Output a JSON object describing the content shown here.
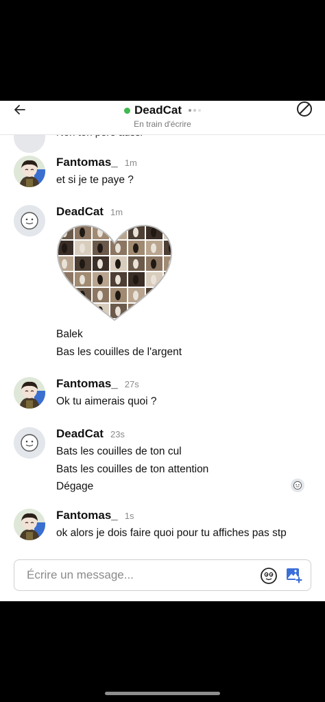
{
  "header": {
    "title": "DeadCat",
    "subtitle": "En train d'écrire",
    "online_color": "#3fb950",
    "back_icon": "arrow-left-icon",
    "block_icon": "block-icon"
  },
  "partial_message": "Non ton père aussi",
  "messages": [
    {
      "author": "Fantomas_",
      "time": "1m",
      "lines": [
        "et si je te paye ?"
      ]
    },
    {
      "author": "DeadCat",
      "time": "1m",
      "image": "heart-collage",
      "lines": [
        "Balek",
        "Bas les couilles de l'argent"
      ]
    },
    {
      "author": "Fantomas_",
      "time": "27s",
      "lines": [
        "Ok tu aimerais quoi ?"
      ]
    },
    {
      "author": "DeadCat",
      "time": "23s",
      "lines": [
        "Bats les couilles de ton cul",
        "Bats les couilles de ton attention",
        "Dégage"
      ]
    },
    {
      "author": "Fantomas_",
      "time": "1s",
      "lines": [
        "ok alors je dois faire quoi pour tu affiches pas stp"
      ]
    }
  ],
  "composer": {
    "placeholder": "Écrire un message...",
    "emoji_icon": "emoji-icon",
    "image_icon": "add-image-icon",
    "accent": "#3b6fd8"
  }
}
